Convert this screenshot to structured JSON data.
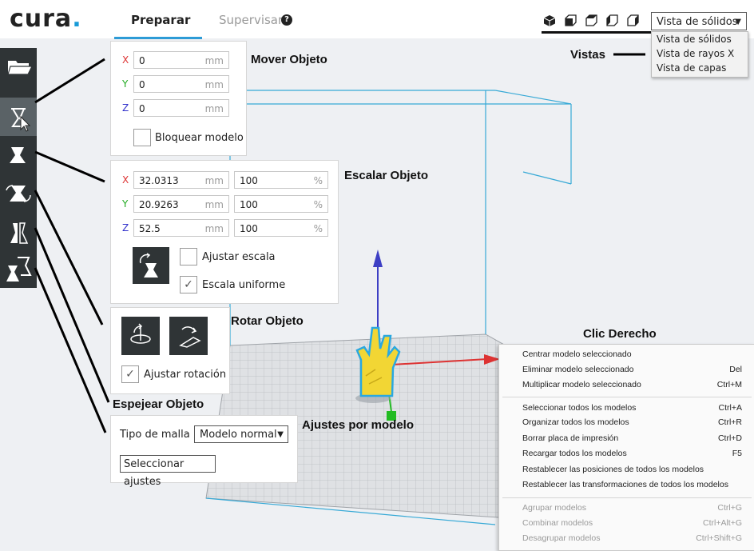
{
  "app": {
    "logo": "cura",
    "logo_dot": "."
  },
  "tabs": [
    {
      "label": "Preparar"
    },
    {
      "label": "Supervisar"
    }
  ],
  "help_glyph": "?",
  "view": {
    "selected": "Vista de sólidos",
    "options": [
      "Vista de sólidos",
      "Vista de rayos X",
      "Vista de capas"
    ],
    "camera_icons": [
      "cube-3d-icon",
      "cube-front-icon",
      "cube-top-icon",
      "cube-left-icon",
      "cube-right-icon"
    ]
  },
  "callouts": {
    "mover": "Mover Objeto",
    "escalar": "Escalar Objeto",
    "rotar": "Rotar Objeto",
    "espejear": "Espejear Objeto",
    "ajustes": "Ajustes por modelo",
    "vistas": "Vistas",
    "clic": "Clic Derecho"
  },
  "toolbar": [
    "folder-icon",
    "move-tool-icon",
    "scale-tool-icon",
    "rotate-tool-icon",
    "mirror-tool-icon",
    "per-model-settings-icon"
  ],
  "move_panel": {
    "x": "0",
    "y": "0",
    "z": "0",
    "unit": "mm",
    "lock_label": "Bloquear modelo",
    "axis_labels": [
      "X",
      "Y",
      "Z"
    ]
  },
  "scale_panel": {
    "x_mm": "32.0313",
    "y_mm": "20.9263",
    "z_mm": "52.5",
    "x_pct": "100",
    "y_pct": "100",
    "z_pct": "100",
    "unit_mm": "mm",
    "unit_pct": "%",
    "snap_label": "Ajustar escala",
    "uniform_label": "Escala uniforme",
    "check": "✓"
  },
  "rotate_panel": {
    "snap_label": "Ajustar rotación"
  },
  "permodel_panel": {
    "mesh_type_label": "Tipo de malla",
    "mesh_type_value": "Modelo normal",
    "select_settings": "Seleccionar ajustes"
  },
  "context_menu": {
    "items": [
      {
        "label": "Centrar modelo seleccionado",
        "key": ""
      },
      {
        "label": "Eliminar modelo seleccionado",
        "key": "Del"
      },
      {
        "label": "Multiplicar modelo seleccionado",
        "key": "Ctrl+M"
      },
      {
        "label": "Seleccionar todos los modelos",
        "key": "Ctrl+A"
      },
      {
        "label": "Organizar todos los modelos",
        "key": "Ctrl+R"
      },
      {
        "label": "Borrar placa de impresión",
        "key": "Ctrl+D"
      },
      {
        "label": "Recargar todos los modelos",
        "key": "F5"
      },
      {
        "label": "Restablecer las posiciones de todos los modelos",
        "key": ""
      },
      {
        "label": "Restablecer las transformaciones de todos los modelos",
        "key": ""
      },
      {
        "label": "Agrupar modelos",
        "key": "Ctrl+G"
      },
      {
        "label": "Combinar modelos",
        "key": "Ctrl+Alt+G"
      },
      {
        "label": "Desagrupar modelos",
        "key": "Ctrl+Shift+G"
      }
    ]
  }
}
